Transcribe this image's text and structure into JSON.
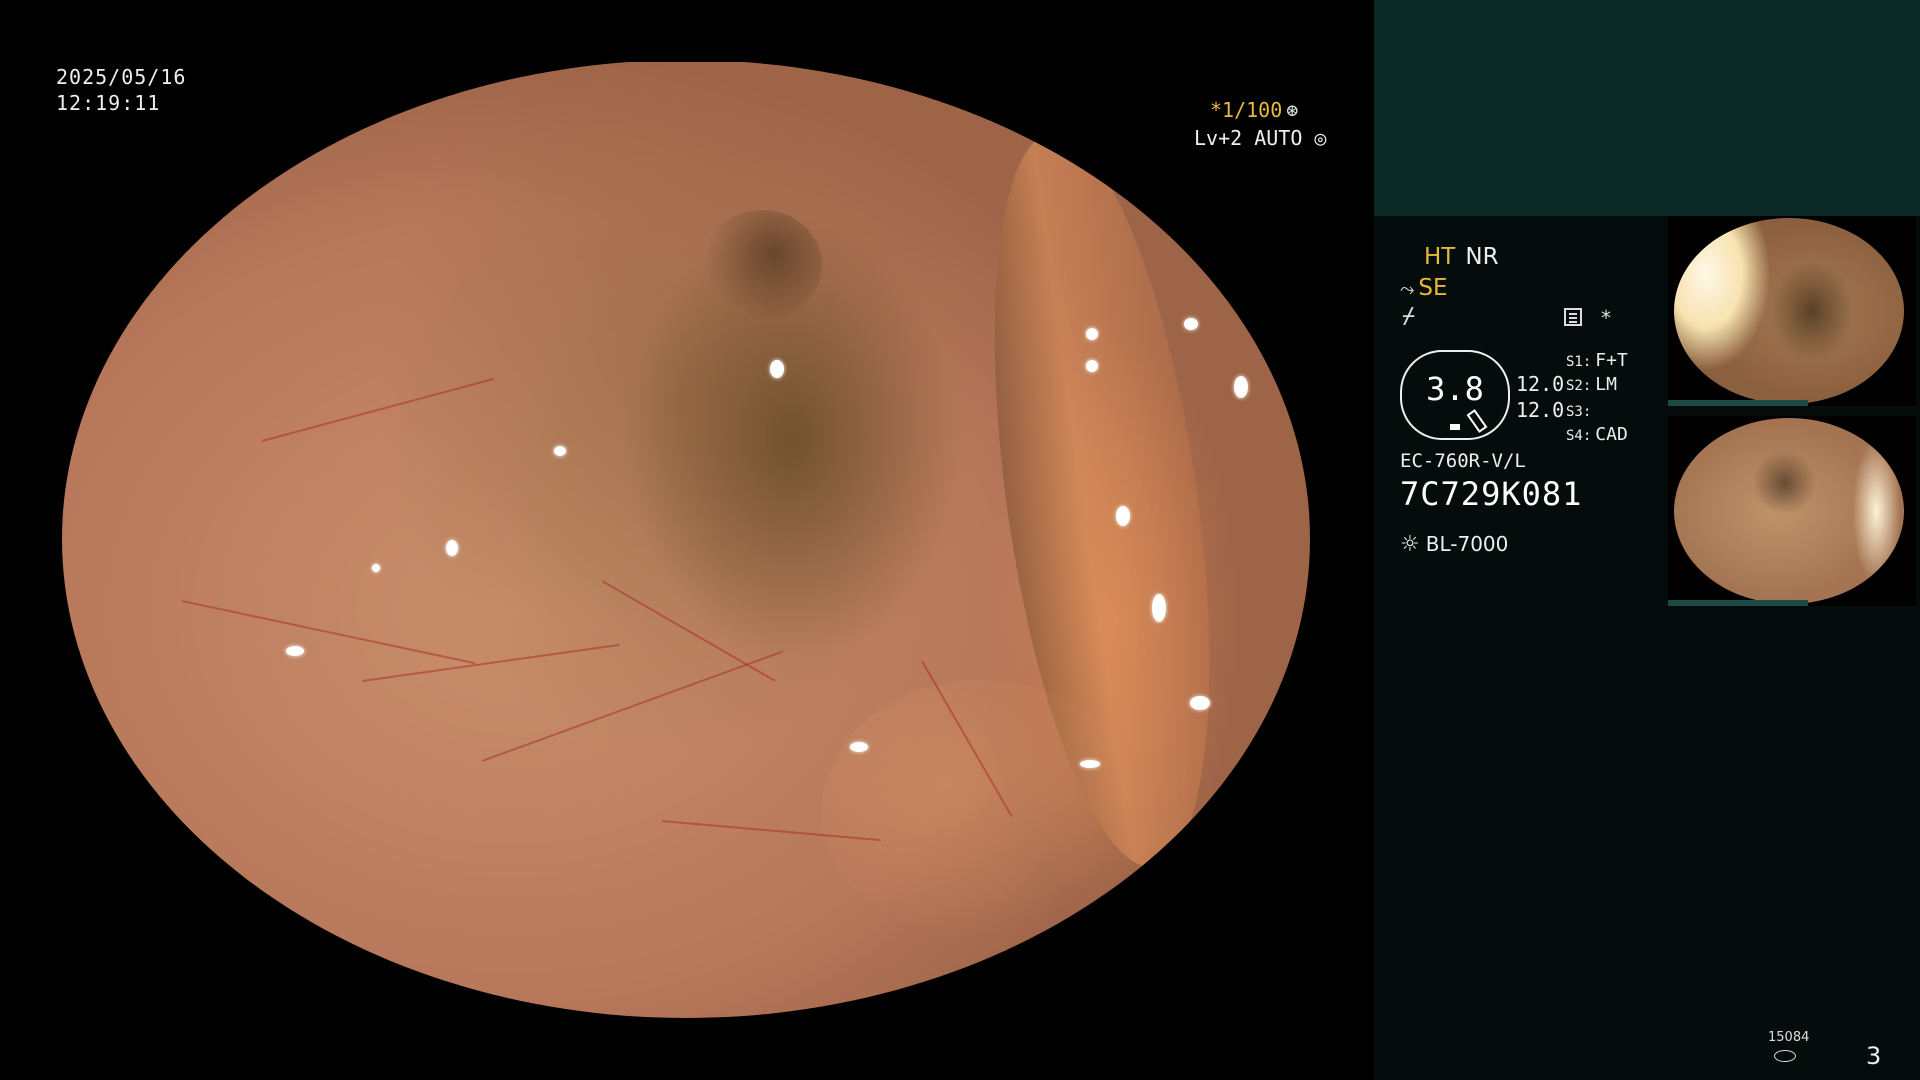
{
  "timestamp": {
    "date": "2025/05/16",
    "time": "12:19:11"
  },
  "shutter": {
    "value": "*1/100",
    "icon": "shutter-icon"
  },
  "level": {
    "value": "Lv+2 AUTO",
    "icon": "auto-iris-icon"
  },
  "enhancement": {
    "ht": "HT",
    "nr": "NR",
    "se": "SE",
    "se_icon": "structure-enhancement-icon",
    "sig_icon": "signal-icon"
  },
  "indicators": {
    "record_icon": "record-icon",
    "star": "*"
  },
  "gauge": {
    "value": "3.8",
    "val1": "12.0",
    "val2": "12.0"
  },
  "slots": [
    {
      "key": "S1:",
      "value": "F+T"
    },
    {
      "key": "S2:",
      "value": "LM"
    },
    {
      "key": "S3:",
      "value": ""
    },
    {
      "key": "S4:",
      "value": "CAD"
    }
  ],
  "scope": {
    "model": "EC-760R-V/L",
    "serial": "7C729K081"
  },
  "light_source": {
    "icon": "lamp-icon",
    "name": "BL-7000"
  },
  "counter": {
    "value": "15084",
    "icon": "storage-icon"
  },
  "page_number": "3",
  "colors": {
    "accent_yellow": "#e8b83a",
    "panel_top": "#0b2a26",
    "panel": "#040d0b"
  }
}
